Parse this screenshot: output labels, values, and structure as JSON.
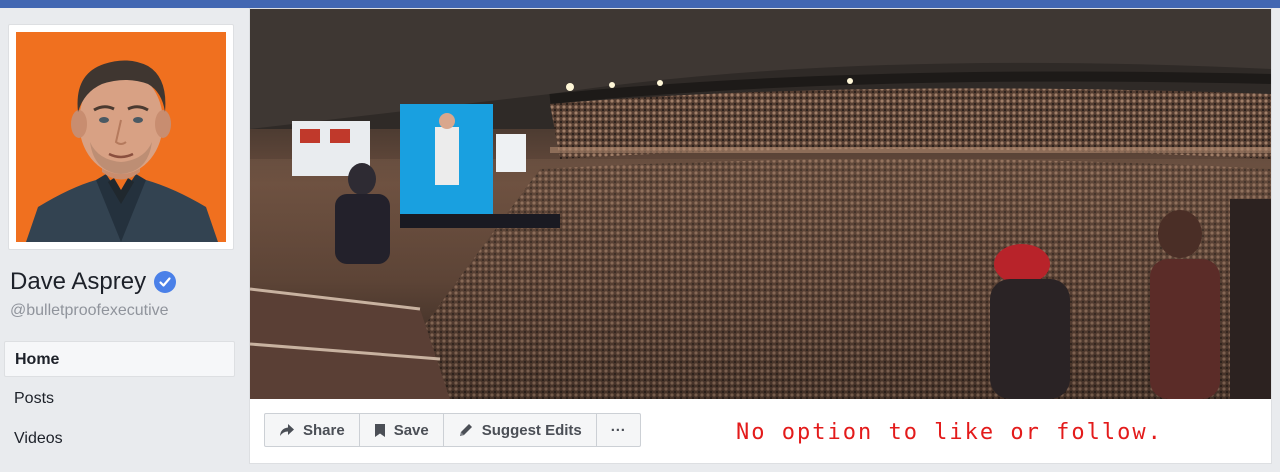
{
  "profile": {
    "name": "Dave Asprey",
    "username": "@bulletproofexecutive",
    "verified_icon": "verified-badge-icon",
    "avatar_bg": "#f0701f"
  },
  "nav": {
    "items": [
      {
        "label": "Home",
        "active": true
      },
      {
        "label": "Posts",
        "active": false
      },
      {
        "label": "Videos",
        "active": false
      }
    ]
  },
  "actions": {
    "share": {
      "label": "Share",
      "icon": "share-arrow-icon"
    },
    "save": {
      "label": "Save",
      "icon": "bookmark-icon"
    },
    "suggest": {
      "label": "Suggest Edits",
      "icon": "pencil-icon"
    },
    "more": {
      "label": "···",
      "icon": "more-icon"
    }
  },
  "annotation": "No option to like or follow.",
  "colors": {
    "brand": "#4267b2",
    "annotation": "#e31b1b",
    "verified": "#4a80e8"
  }
}
